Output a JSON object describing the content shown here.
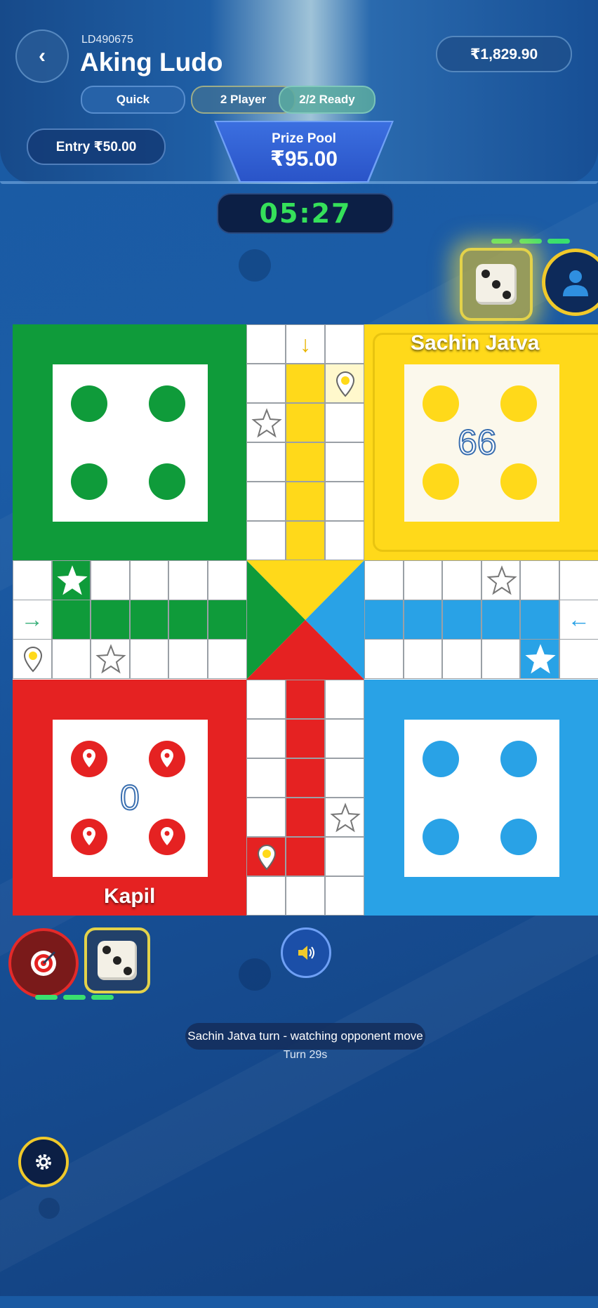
{
  "header": {
    "room_id": "LD490675",
    "title": "Aking Ludo",
    "balance": "₹1,829.90",
    "tags": {
      "mode": "Quick",
      "players": "2 Player",
      "ready": "2/2 Ready"
    },
    "entry": "Entry ₹50.00",
    "prize_label": "Prize Pool",
    "prize_value": "₹95.00",
    "timer": "05:27"
  },
  "players": {
    "top": {
      "name": "Sachin Jatva",
      "score": "66",
      "color": "#ffd91a"
    },
    "bottom": {
      "name": "Kapil",
      "score": "0",
      "color": "#e52222"
    }
  },
  "status": {
    "message": "Sachin Jatva turn - watching opponent move",
    "turn": "Turn 29s"
  },
  "colors": {
    "green": "#0f9b3a",
    "yellow": "#ffd91a",
    "red": "#e52222",
    "blue": "#29a2e6"
  },
  "icons": [
    "back-icon",
    "dice-icon",
    "avatar-icon",
    "target-icon",
    "sound-icon",
    "settings-icon",
    "star-icon",
    "arrow-icon",
    "map-pin-icon"
  ]
}
